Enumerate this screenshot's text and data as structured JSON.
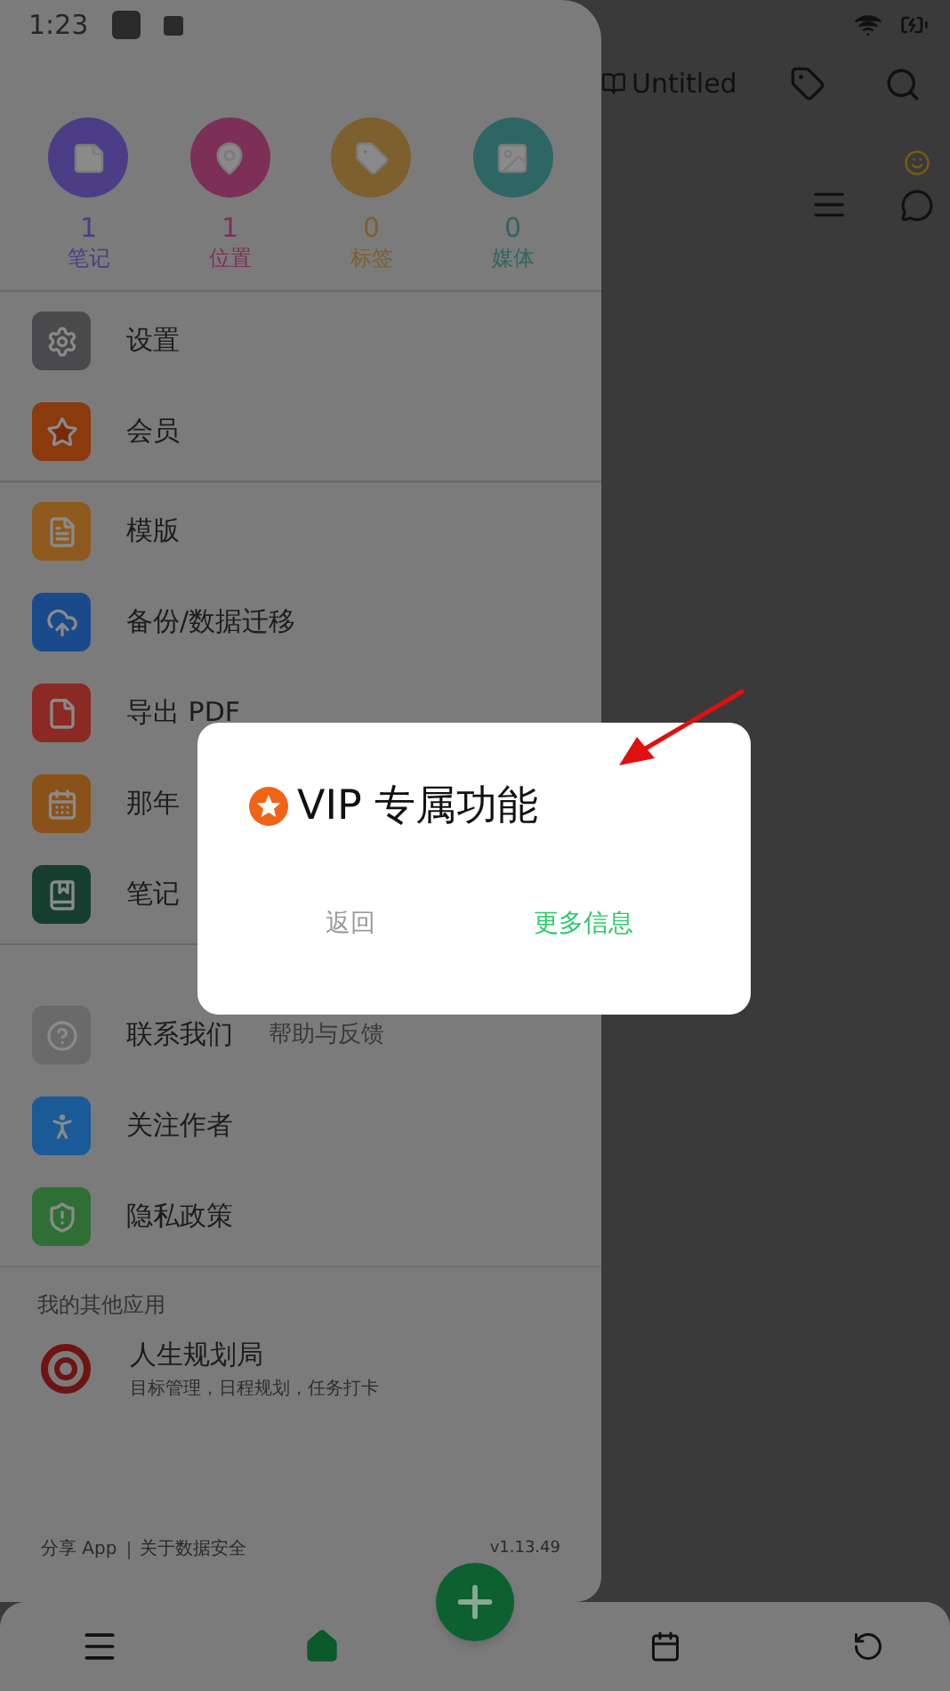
{
  "status_bar": {
    "time": "1:23"
  },
  "toolbar": {
    "title": "Untitled"
  },
  "drawer": {
    "stats": [
      {
        "count": "1",
        "label": "笔记",
        "color": "#4b3d86",
        "kind": "note"
      },
      {
        "count": "1",
        "label": "位置",
        "color": "#7d3057",
        "kind": "location"
      },
      {
        "count": "0",
        "label": "标签",
        "color": "#7d602e",
        "kind": "tag"
      },
      {
        "count": "0",
        "label": "媒体",
        "color": "#2e6664",
        "kind": "media"
      }
    ],
    "menu_groups": [
      [
        {
          "label": "设置",
          "kind": "settings",
          "color": "#4a4a4c"
        },
        {
          "label": "会员",
          "kind": "member",
          "color": "#8a3a0c"
        }
      ],
      [
        {
          "label": "模版",
          "kind": "template",
          "color": "#8f5a1e"
        },
        {
          "label": "备份/数据迁移",
          "kind": "backup",
          "color": "#1b4a8c"
        },
        {
          "label": "导出 PDF",
          "kind": "pdf",
          "color": "#8a2a22"
        },
        {
          "label": "那年",
          "kind": "calendar",
          "color": "#8a5218"
        },
        {
          "label": "笔记",
          "kind": "notebook",
          "color": "#163f30"
        }
      ],
      [
        {
          "label": "联系我们",
          "hint": "帮助与反馈",
          "kind": "help",
          "color": "#6a6a6a"
        },
        {
          "label": "关注作者",
          "kind": "author",
          "color": "#1a5a96"
        },
        {
          "label": "隐私政策",
          "kind": "privacy",
          "color": "#2f6f35"
        }
      ]
    ],
    "other_apps_heading": "我的其他应用",
    "other_app": {
      "name": "人生规划局",
      "subtitle": "目标管理，日程规划，任务打卡"
    },
    "footer": {
      "share": "分享 App",
      "data_security": "关于数据安全",
      "version": "v1.13.49"
    }
  },
  "dialog": {
    "title": "VIP 专属功能",
    "cancel": "返回",
    "confirm": "更多信息"
  }
}
